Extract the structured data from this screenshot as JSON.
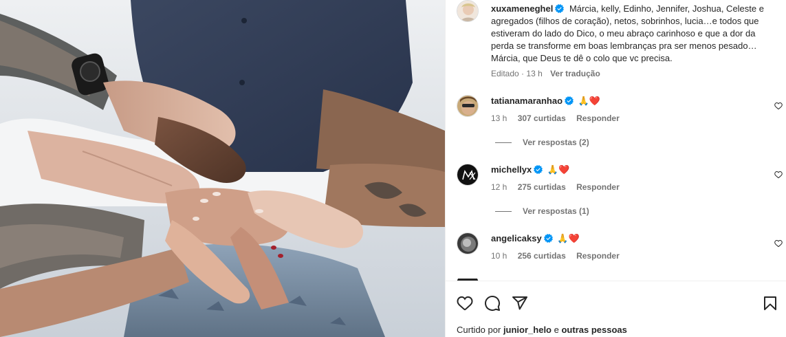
{
  "post": {
    "author": "xuxameneghel",
    "caption": "Márcia, kelly, Edinho, Jennifer, Joshua, Celeste e agregados (filhos de coração), netos, sobrinhos, lucia…e todos que estiveram do lado do Dico, o meu abraço carinhoso e que a dor da perda se transforme em boas lembranças pra ser menos pesado… Márcia, que Deus te dê o colo que vc precisa.",
    "edited_label": "Editado",
    "time": "13 h",
    "see_translation": "Ver tradução"
  },
  "comments": [
    {
      "username": "tatianamaranhao",
      "emoji": "🙏❤️",
      "time": "13 h",
      "likes": "307 curtidas",
      "reply_label": "Responder",
      "view_replies": "Ver respostas (2)"
    },
    {
      "username": "michellyx",
      "emoji": "🙏❤️",
      "time": "12 h",
      "likes": "275 curtidas",
      "reply_label": "Responder",
      "view_replies": "Ver respostas (1)"
    },
    {
      "username": "angelicaksy",
      "emoji": "🙏❤️",
      "time": "10 h",
      "likes": "256 curtidas",
      "reply_label": "Responder"
    }
  ],
  "footer": {
    "liked_prefix": "Curtido por",
    "liked_user": "junior_helo",
    "liked_conj": "e",
    "liked_others": "outras pessoas"
  },
  "icons": {
    "like": "heart-icon",
    "comment": "comment-icon",
    "share": "paper-plane-icon",
    "save": "bookmark-icon",
    "verified": "verified-badge-icon",
    "comment_like": "small-heart-icon"
  },
  "colors": {
    "verified": "#0095f6",
    "text": "#262626",
    "secondary": "#737373",
    "heart_emoji": "#e0245e"
  }
}
